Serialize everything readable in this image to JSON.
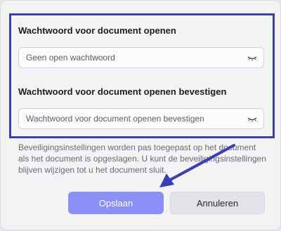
{
  "dialog": {
    "password_open_label": "Wachtwoord voor document openen",
    "password_open_placeholder": "Geen open wachtwoord",
    "password_confirm_label": "Wachtwoord voor document openen bevestigen",
    "password_confirm_placeholder": "Wachtwoord voor document openen bevestigen",
    "helper_text": "Beveiligingsinstellingen worden pas toegepast op het document als het document is opgeslagen. U kunt de beveiligingsinstellingen blijven wijzigen tot u het document sluit.",
    "save_label": "Opslaan",
    "cancel_label": "Annuleren"
  },
  "annotation": {
    "highlight_color": "#3b3fb0",
    "arrow_color": "#3b3fb0"
  },
  "colors": {
    "primary_button": "#8b8ff7",
    "secondary_button": "#e3e2e6"
  },
  "icons": [
    "eye-hidden-icon",
    "eye-hidden-icon"
  ]
}
